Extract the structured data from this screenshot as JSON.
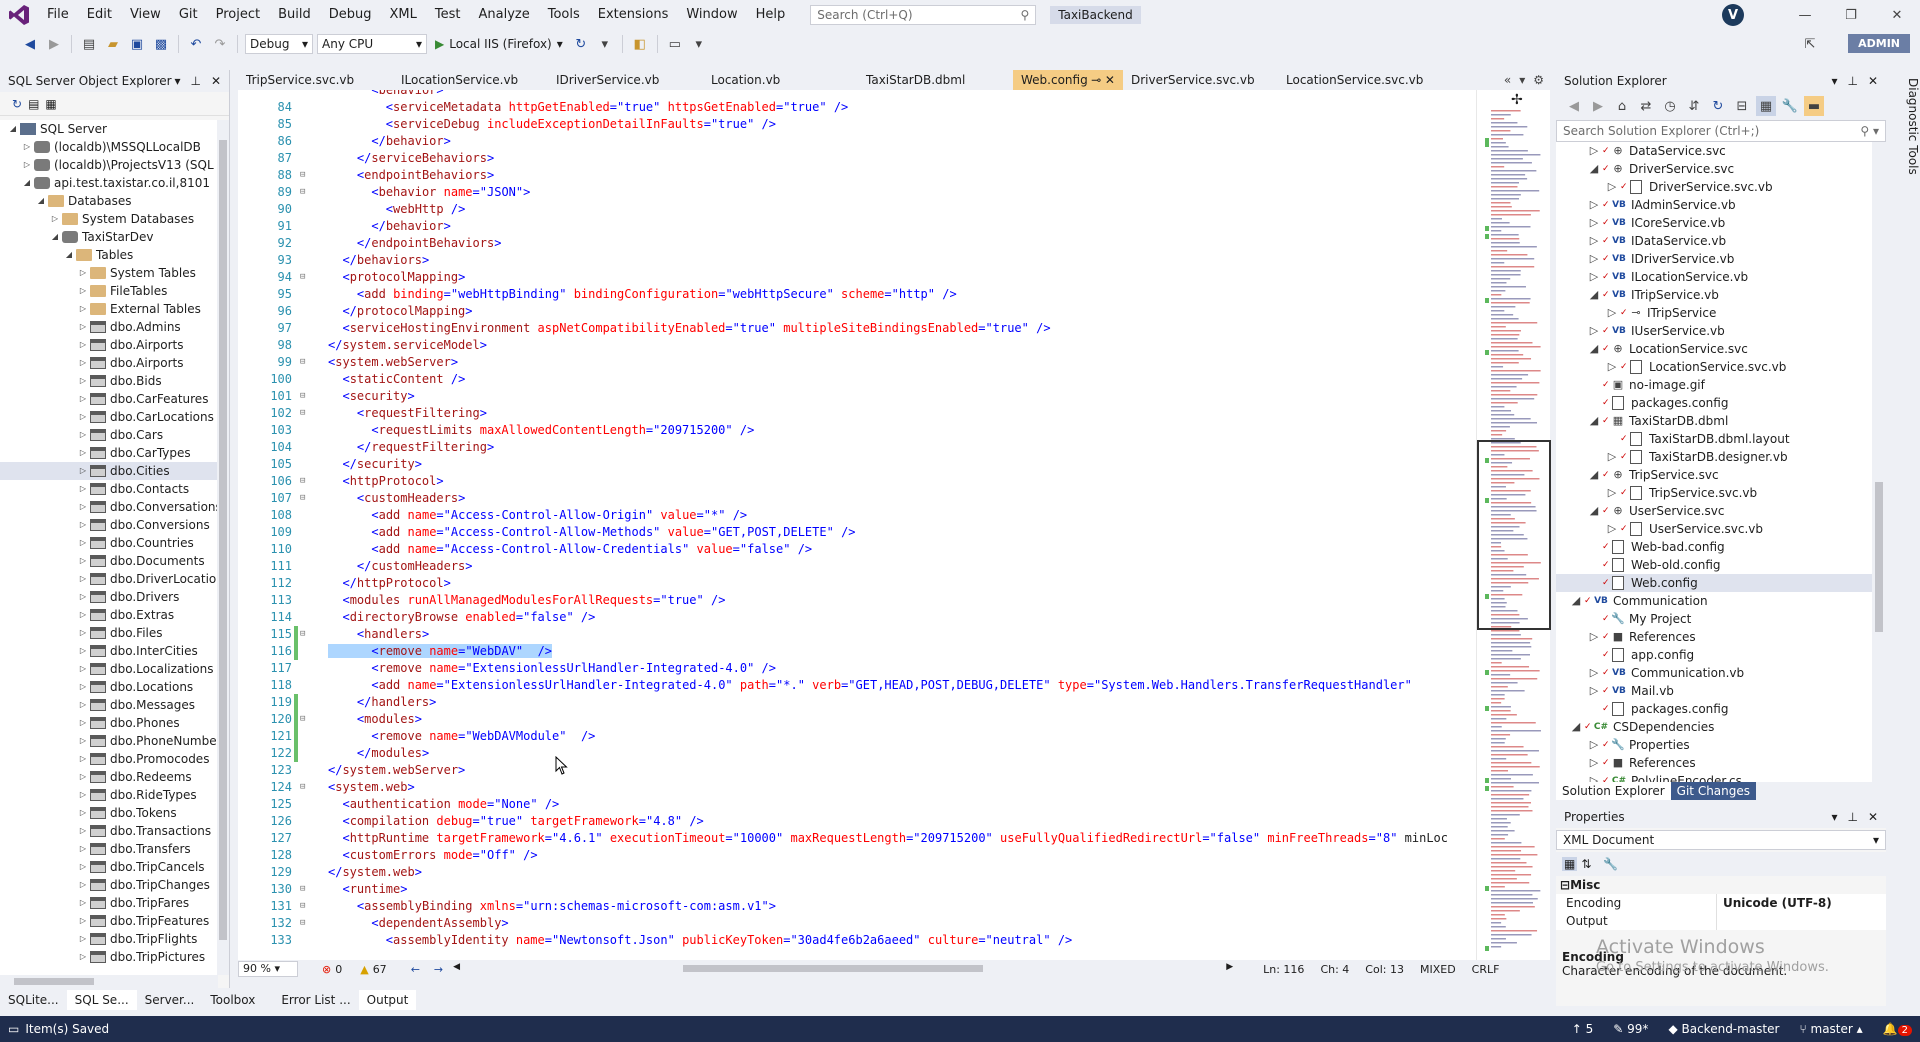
{
  "menu": [
    "File",
    "Edit",
    "View",
    "Git",
    "Project",
    "Build",
    "Debug",
    "XML",
    "Test",
    "Analyze",
    "Tools",
    "Extensions",
    "Window",
    "Help"
  ],
  "search": {
    "placeholder": "Search (Ctrl+Q)"
  },
  "project_title": "TaxiBackend",
  "user_initial": "V",
  "toolbar": {
    "config": "Debug",
    "platform": "Any CPU",
    "run_target": "Local IIS (Firefox)",
    "admin_label": "ADMIN"
  },
  "left_panel": {
    "title": "SQL Server Object Explorer",
    "tree": [
      {
        "indent": 0,
        "twisty": "◢",
        "icon": "server",
        "label": "SQL Server"
      },
      {
        "indent": 1,
        "twisty": "▷",
        "icon": "db",
        "label": "(localdb)\\MSSQLLocalDB"
      },
      {
        "indent": 1,
        "twisty": "▷",
        "icon": "db",
        "label": "(localdb)\\ProjectsV13 (SQL"
      },
      {
        "indent": 1,
        "twisty": "◢",
        "icon": "db",
        "label": "api.test.taxistar.co.il,8101"
      },
      {
        "indent": 2,
        "twisty": "◢",
        "icon": "folder",
        "label": "Databases"
      },
      {
        "indent": 3,
        "twisty": "▷",
        "icon": "folder",
        "label": "System Databases"
      },
      {
        "indent": 3,
        "twisty": "◢",
        "icon": "db",
        "label": "TaxiStarDev"
      },
      {
        "indent": 4,
        "twisty": "◢",
        "icon": "folder",
        "label": "Tables"
      },
      {
        "indent": 5,
        "twisty": "▷",
        "icon": "folder",
        "label": "System Tables"
      },
      {
        "indent": 5,
        "twisty": "▷",
        "icon": "folder",
        "label": "FileTables"
      },
      {
        "indent": 5,
        "twisty": "▷",
        "icon": "folder",
        "label": "External Tables"
      },
      {
        "indent": 5,
        "twisty": "▷",
        "icon": "table",
        "label": "dbo.Admins"
      },
      {
        "indent": 5,
        "twisty": "▷",
        "icon": "table",
        "label": "dbo.Airports"
      },
      {
        "indent": 5,
        "twisty": "▷",
        "icon": "table",
        "label": "dbo.Airports"
      },
      {
        "indent": 5,
        "twisty": "▷",
        "icon": "table",
        "label": "dbo.Bids"
      },
      {
        "indent": 5,
        "twisty": "▷",
        "icon": "table",
        "label": "dbo.CarFeatures"
      },
      {
        "indent": 5,
        "twisty": "▷",
        "icon": "table",
        "label": "dbo.CarLocations"
      },
      {
        "indent": 5,
        "twisty": "▷",
        "icon": "table",
        "label": "dbo.Cars"
      },
      {
        "indent": 5,
        "twisty": "▷",
        "icon": "table",
        "label": "dbo.CarTypes"
      },
      {
        "indent": 5,
        "twisty": "▷",
        "icon": "table",
        "label": "dbo.Cities",
        "selected": true
      },
      {
        "indent": 5,
        "twisty": "▷",
        "icon": "table",
        "label": "dbo.Contacts"
      },
      {
        "indent": 5,
        "twisty": "▷",
        "icon": "table",
        "label": "dbo.Conversations"
      },
      {
        "indent": 5,
        "twisty": "▷",
        "icon": "table",
        "label": "dbo.Conversions"
      },
      {
        "indent": 5,
        "twisty": "▷",
        "icon": "table",
        "label": "dbo.Countries"
      },
      {
        "indent": 5,
        "twisty": "▷",
        "icon": "table",
        "label": "dbo.Documents"
      },
      {
        "indent": 5,
        "twisty": "▷",
        "icon": "table",
        "label": "dbo.DriverLocations"
      },
      {
        "indent": 5,
        "twisty": "▷",
        "icon": "table",
        "label": "dbo.Drivers"
      },
      {
        "indent": 5,
        "twisty": "▷",
        "icon": "table",
        "label": "dbo.Extras"
      },
      {
        "indent": 5,
        "twisty": "▷",
        "icon": "table",
        "label": "dbo.Files"
      },
      {
        "indent": 5,
        "twisty": "▷",
        "icon": "table",
        "label": "dbo.InterCities"
      },
      {
        "indent": 5,
        "twisty": "▷",
        "icon": "table",
        "label": "dbo.Localizations"
      },
      {
        "indent": 5,
        "twisty": "▷",
        "icon": "table",
        "label": "dbo.Locations"
      },
      {
        "indent": 5,
        "twisty": "▷",
        "icon": "table",
        "label": "dbo.Messages"
      },
      {
        "indent": 5,
        "twisty": "▷",
        "icon": "table",
        "label": "dbo.Phones"
      },
      {
        "indent": 5,
        "twisty": "▷",
        "icon": "table",
        "label": "dbo.PhoneNumbers"
      },
      {
        "indent": 5,
        "twisty": "▷",
        "icon": "table",
        "label": "dbo.Promocodes"
      },
      {
        "indent": 5,
        "twisty": "▷",
        "icon": "table",
        "label": "dbo.Redeems"
      },
      {
        "indent": 5,
        "twisty": "▷",
        "icon": "table",
        "label": "dbo.RideTypes"
      },
      {
        "indent": 5,
        "twisty": "▷",
        "icon": "table",
        "label": "dbo.Tokens"
      },
      {
        "indent": 5,
        "twisty": "▷",
        "icon": "table",
        "label": "dbo.Transactions"
      },
      {
        "indent": 5,
        "twisty": "▷",
        "icon": "table",
        "label": "dbo.Transfers"
      },
      {
        "indent": 5,
        "twisty": "▷",
        "icon": "table",
        "label": "dbo.TripCancels"
      },
      {
        "indent": 5,
        "twisty": "▷",
        "icon": "table",
        "label": "dbo.TripChanges"
      },
      {
        "indent": 5,
        "twisty": "▷",
        "icon": "table",
        "label": "dbo.TripFares"
      },
      {
        "indent": 5,
        "twisty": "▷",
        "icon": "table",
        "label": "dbo.TripFeatures"
      },
      {
        "indent": 5,
        "twisty": "▷",
        "icon": "table",
        "label": "dbo.TripFlights"
      },
      {
        "indent": 5,
        "twisty": "▷",
        "icon": "table",
        "label": "dbo.TripPictures"
      }
    ]
  },
  "tabs": [
    {
      "label": "TripService.svc.vb"
    },
    {
      "label": "ILocationService.vb"
    },
    {
      "label": "IDriverService.vb"
    },
    {
      "label": "Location.vb"
    },
    {
      "label": "TaxiStarDB.dbml"
    },
    {
      "label": "Web.config",
      "active": true
    },
    {
      "label": "DriverService.svc.vb"
    },
    {
      "label": "LocationService.svc.vb"
    }
  ],
  "code": [
    {
      "n": "",
      "t": "      <behavior>"
    },
    {
      "n": "84",
      "t": "        <serviceMetadata httpGetEnabled=\"true\" httpsGetEnabled=\"true\" />"
    },
    {
      "n": "85",
      "t": "        <serviceDebug includeExceptionDetailInFaults=\"true\" />"
    },
    {
      "n": "86",
      "t": "      </behavior>"
    },
    {
      "n": "87",
      "t": "    </serviceBehaviors>"
    },
    {
      "n": "88",
      "t": "    <endpointBehaviors>",
      "fold": true
    },
    {
      "n": "89",
      "t": "      <behavior name=\"JSON\">",
      "fold": true
    },
    {
      "n": "90",
      "t": "        <webHttp />"
    },
    {
      "n": "91",
      "t": "      </behavior>"
    },
    {
      "n": "92",
      "t": "    </endpointBehaviors>"
    },
    {
      "n": "93",
      "t": "  </behaviors>"
    },
    {
      "n": "94",
      "t": "  <protocolMapping>",
      "fold": true
    },
    {
      "n": "95",
      "t": "    <add binding=\"webHttpBinding\" bindingConfiguration=\"webHttpSecure\" scheme=\"http\" />"
    },
    {
      "n": "96",
      "t": "  </protocolMapping>"
    },
    {
      "n": "97",
      "t": "  <serviceHostingEnvironment aspNetCompatibilityEnabled=\"true\" multipleSiteBindingsEnabled=\"true\" />"
    },
    {
      "n": "98",
      "t": "</system.serviceModel>"
    },
    {
      "n": "99",
      "t": "<system.webServer>",
      "fold": true
    },
    {
      "n": "100",
      "t": "  <staticContent />"
    },
    {
      "n": "101",
      "t": "  <security>",
      "fold": true
    },
    {
      "n": "102",
      "t": "    <requestFiltering>",
      "fold": true
    },
    {
      "n": "103",
      "t": "      <requestLimits maxAllowedContentLength=\"209715200\" />"
    },
    {
      "n": "104",
      "t": "    </requestFiltering>"
    },
    {
      "n": "105",
      "t": "  </security>"
    },
    {
      "n": "106",
      "t": "  <httpProtocol>",
      "fold": true
    },
    {
      "n": "107",
      "t": "    <customHeaders>",
      "fold": true
    },
    {
      "n": "108",
      "t": "      <add name=\"Access-Control-Allow-Origin\" value=\"*\" />"
    },
    {
      "n": "109",
      "t": "      <add name=\"Access-Control-Allow-Methods\" value=\"GET,POST,DELETE\" />"
    },
    {
      "n": "110",
      "t": "      <add name=\"Access-Control-Allow-Credentials\" value=\"false\" />"
    },
    {
      "n": "111",
      "t": "    </customHeaders>"
    },
    {
      "n": "112",
      "t": "  </httpProtocol>"
    },
    {
      "n": "113",
      "t": "  <modules runAllManagedModulesForAllRequests=\"true\" />"
    },
    {
      "n": "114",
      "t": "  <directoryBrowse enabled=\"false\" />"
    },
    {
      "n": "115",
      "t": "    <handlers>",
      "fold": true,
      "changed": true
    },
    {
      "n": "116",
      "t": "      <remove name=\"WebDAV\"  />",
      "hl": true,
      "changed": true
    },
    {
      "n": "117",
      "t": "      <remove name=\"ExtensionlessUrlHandler-Integrated-4.0\" />"
    },
    {
      "n": "118",
      "t": "      <add name=\"ExtensionlessUrlHandler-Integrated-4.0\" path=\"*.\" verb=\"GET,HEAD,POST,DEBUG,DELETE\" type=\"System.Web.Handlers.TransferRequestHandler\""
    },
    {
      "n": "119",
      "t": "    </handlers>",
      "changed": true
    },
    {
      "n": "120",
      "t": "    <modules>",
      "fold": true,
      "changed": true
    },
    {
      "n": "121",
      "t": "      <remove name=\"WebDAVModule\"  />",
      "changed": true
    },
    {
      "n": "122",
      "t": "    </modules>",
      "changed": true
    },
    {
      "n": "123",
      "t": "</system.webServer>"
    },
    {
      "n": "124",
      "t": "<system.web>",
      "fold": true
    },
    {
      "n": "125",
      "t": "  <authentication mode=\"None\" />"
    },
    {
      "n": "126",
      "t": "  <compilation debug=\"true\" targetFramework=\"4.8\" />"
    },
    {
      "n": "127",
      "t": "  <httpRuntime targetFramework=\"4.6.1\" executionTimeout=\"10000\" maxRequestLength=\"209715200\" useFullyQualifiedRedirectUrl=\"false\" minFreeThreads=\"8\" minLoc"
    },
    {
      "n": "128",
      "t": "  <customErrors mode=\"Off\" />"
    },
    {
      "n": "129",
      "t": "</system.web>"
    },
    {
      "n": "130",
      "t": "  <runtime>",
      "fold": true
    },
    {
      "n": "131",
      "t": "    <assemblyBinding xmlns=\"urn:schemas-microsoft-com:asm.v1\">",
      "fold": true
    },
    {
      "n": "132",
      "t": "      <dependentAssembly>",
      "fold": true
    },
    {
      "n": "133",
      "t": "        <assemblyIdentity name=\"Newtonsoft.Json\" publicKeyToken=\"30ad4fe6b2a6aeed\" culture=\"neutral\" />"
    }
  ],
  "editor_status": {
    "zoom": "90 %",
    "errors": "0",
    "warnings": "67",
    "ln": "Ln: 116",
    "ch": "Ch: 4",
    "col": "Col: 13",
    "mode": "MIXED",
    "eol": "CRLF"
  },
  "bottom_tabs": [
    {
      "label": "SQLite..."
    },
    {
      "label": "SQL Se...",
      "active": true
    },
    {
      "label": "Server..."
    },
    {
      "label": "Toolbox"
    },
    {
      "label": "Error List ..."
    },
    {
      "label": "Output",
      "active": true
    }
  ],
  "status": {
    "message": "Item(s) Saved",
    "up": "5",
    "pencil": "99*",
    "repo": "Backend-master",
    "branch": "master",
    "notifications": "2"
  },
  "solution": {
    "title": "Solution Explorer",
    "search_placeholder": "Search Solution Explorer (Ctrl+;)",
    "tree": [
      {
        "indent": 1,
        "tw": "▷",
        "ic": "⊕",
        "label": "DataService.svc"
      },
      {
        "indent": 1,
        "tw": "◢",
        "ic": "⊕",
        "label": "DriverService.svc"
      },
      {
        "indent": 2,
        "tw": "▷",
        "ic": "file",
        "label": "DriverService.svc.vb"
      },
      {
        "indent": 1,
        "tw": "▷",
        "ic": "VB",
        "label": "IAdminService.vb"
      },
      {
        "indent": 1,
        "tw": "▷",
        "ic": "VB",
        "label": "ICoreService.vb"
      },
      {
        "indent": 1,
        "tw": "▷",
        "ic": "VB",
        "label": "IDataService.vb"
      },
      {
        "indent": 1,
        "tw": "▷",
        "ic": "VB",
        "label": "IDriverService.vb"
      },
      {
        "indent": 1,
        "tw": "▷",
        "ic": "VB",
        "label": "ILocationService.vb"
      },
      {
        "indent": 1,
        "tw": "◢",
        "ic": "VB",
        "label": "ITripService.vb"
      },
      {
        "indent": 2,
        "tw": "▷",
        "ic": "⊸",
        "label": "ITripService"
      },
      {
        "indent": 1,
        "tw": "▷",
        "ic": "VB",
        "label": "IUserService.vb"
      },
      {
        "indent": 1,
        "tw": "◢",
        "ic": "⊕",
        "label": "LocationService.svc"
      },
      {
        "indent": 2,
        "tw": "▷",
        "ic": "file",
        "label": "LocationService.svc.vb"
      },
      {
        "indent": 1,
        "tw": "",
        "ic": "▣",
        "label": "no-image.gif"
      },
      {
        "indent": 1,
        "tw": "",
        "ic": "file",
        "label": "packages.config"
      },
      {
        "indent": 1,
        "tw": "◢",
        "ic": "▦",
        "label": "TaxiStarDB.dbml"
      },
      {
        "indent": 2,
        "tw": "",
        "ic": "file",
        "label": "TaxiStarDB.dbml.layout"
      },
      {
        "indent": 2,
        "tw": "▷",
        "ic": "file",
        "label": "TaxiStarDB.designer.vb"
      },
      {
        "indent": 1,
        "tw": "◢",
        "ic": "⊕",
        "label": "TripService.svc"
      },
      {
        "indent": 2,
        "tw": "▷",
        "ic": "file",
        "label": "TripService.svc.vb"
      },
      {
        "indent": 1,
        "tw": "◢",
        "ic": "⊕",
        "label": "UserService.svc"
      },
      {
        "indent": 2,
        "tw": "▷",
        "ic": "file",
        "label": "UserService.svc.vb"
      },
      {
        "indent": 1,
        "tw": "",
        "ic": "file",
        "label": "Web-bad.config"
      },
      {
        "indent": 1,
        "tw": "",
        "ic": "file",
        "label": "Web-old.config"
      },
      {
        "indent": 1,
        "tw": "",
        "ic": "file",
        "label": "Web.config",
        "selected": true
      },
      {
        "indent": 0,
        "tw": "◢",
        "ic": "VB",
        "label": "Communication"
      },
      {
        "indent": 1,
        "tw": "",
        "ic": "🔧",
        "label": "My Project"
      },
      {
        "indent": 1,
        "tw": "▷",
        "ic": "■",
        "label": "References"
      },
      {
        "indent": 1,
        "tw": "",
        "ic": "file",
        "label": "app.config"
      },
      {
        "indent": 1,
        "tw": "▷",
        "ic": "VB",
        "label": "Communication.vb"
      },
      {
        "indent": 1,
        "tw": "▷",
        "ic": "VB",
        "label": "Mail.vb"
      },
      {
        "indent": 1,
        "tw": "",
        "ic": "file",
        "label": "packages.config"
      },
      {
        "indent": 0,
        "tw": "◢",
        "ic": "C#",
        "label": "CSDependencies"
      },
      {
        "indent": 1,
        "tw": "▷",
        "ic": "🔧",
        "label": "Properties"
      },
      {
        "indent": 1,
        "tw": "▷",
        "ic": "■",
        "label": "References"
      },
      {
        "indent": 1,
        "tw": "▷",
        "ic": "C#",
        "label": "PolylineEncoder.cs"
      }
    ],
    "bottom_tabs": [
      {
        "label": "Solution Explorer",
        "active": true
      },
      {
        "label": "Git Changes"
      }
    ]
  },
  "properties": {
    "title": "Properties",
    "object": "XML Document",
    "category": "Misc",
    "rows": [
      {
        "name": "Encoding",
        "value": "Unicode (UTF-8)"
      },
      {
        "name": "Output",
        "value": ""
      }
    ],
    "desc_title": "Encoding",
    "desc_text": "Character encoding of the document.",
    "watermark": "Activate Windows",
    "watermark_sub": "Go to Settings to activate Windows."
  },
  "diagnostic_tools": "Diagnostic Tools"
}
